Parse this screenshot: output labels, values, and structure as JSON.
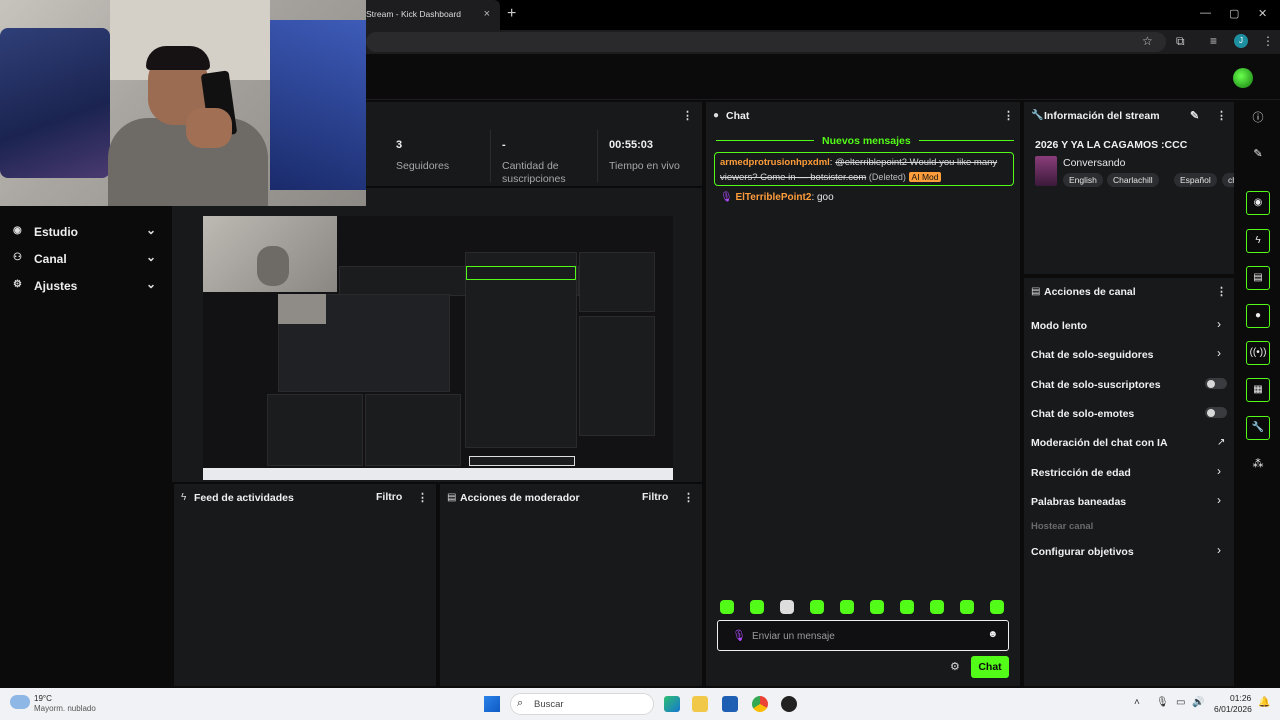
{
  "browser": {
    "tab_title": "Stream - Kick Dashboard",
    "tab_close": "×",
    "new_tab": "+",
    "window_controls": [
      "—",
      "▢",
      "✕"
    ],
    "profile_initial": "J"
  },
  "sidebar": {
    "items": [
      {
        "label": "Estudio",
        "icon": "studio-icon"
      },
      {
        "label": "Canal",
        "icon": "channel-icon"
      },
      {
        "label": "Ajustes",
        "icon": "settings-icon"
      }
    ]
  },
  "stats": {
    "followers_value": "3",
    "followers_label": "Seguidores",
    "subs_value": "-",
    "subs_label": "Cantidad de suscripciones",
    "live_value": "00:55:03",
    "live_label": "Tiempo en vivo"
  },
  "feed": {
    "title": "Feed de actividades",
    "filter": "Filtro"
  },
  "mod_actions": {
    "title": "Acciones de moderador",
    "filter": "Filtro"
  },
  "chat": {
    "title": "Chat",
    "new_messages": "Nuevos mensajes",
    "messages": [
      {
        "user": "armedprotrusionhpxdml",
        "text": "@elterriblepoint2 Would you like many viewers? Come in — botsister.com",
        "deleted": "(Deleted)",
        "badge": "AI Mod"
      },
      {
        "user": "ElTerriblePoint2",
        "text": "goo"
      }
    ],
    "input_placeholder": "Enviar un mensaje",
    "send_label": "Chat"
  },
  "stream_info": {
    "title": "Información del stream",
    "stream_title": "2026 Y YA LA CAGAMOS :CCC",
    "category": "Conversando",
    "tags": [
      "English",
      "Charlachill",
      "Español",
      "ch"
    ]
  },
  "channel_actions": {
    "title": "Acciones de canal",
    "items": [
      {
        "label": "Modo lento",
        "control": "chevron"
      },
      {
        "label": "Chat de solo-seguidores",
        "control": "chevron"
      },
      {
        "label": "Chat de solo-suscriptores",
        "control": "toggle"
      },
      {
        "label": "Chat de solo-emotes",
        "control": "toggle"
      },
      {
        "label": "Moderación del chat con IA",
        "control": "external"
      },
      {
        "label": "Restricción de edad",
        "control": "chevron"
      },
      {
        "label": "Palabras baneadas",
        "control": "chevron"
      },
      {
        "label": "Hostear canal",
        "control": "disabled"
      },
      {
        "label": "Configurar objetivos",
        "control": "chevron"
      }
    ]
  },
  "taskbar": {
    "temperature": "19°C",
    "weather": "Mayorm. nublado",
    "search_placeholder": "Buscar",
    "time": "01:26",
    "date": "6/01/2026"
  },
  "colors": {
    "accent": "#53fc18",
    "background": "#0b0b0c",
    "panel": "#18191b",
    "username_orange": "#ff9d3a",
    "username_purple": "#b04aff"
  }
}
